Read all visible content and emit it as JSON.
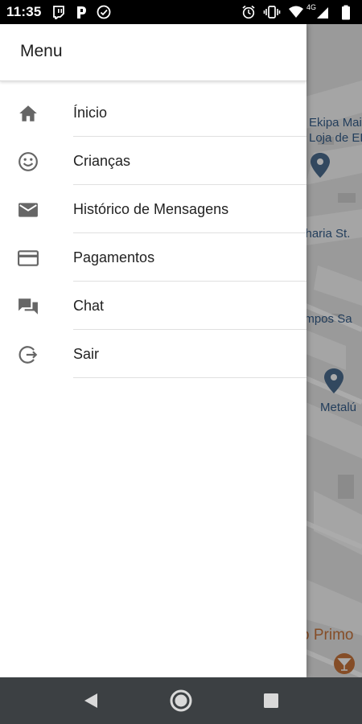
{
  "status_bar": {
    "time": "11:35",
    "left_icons": [
      "twitch-icon",
      "p-icon",
      "check-circle-icon"
    ],
    "right_icons": [
      "alarm-icon",
      "vibrate-icon",
      "wifi-icon",
      "signal-4g-icon",
      "battery-icon"
    ],
    "network": "4G"
  },
  "drawer": {
    "title": "Menu",
    "items": [
      {
        "label": "Ínicio",
        "icon": "home-icon"
      },
      {
        "label": "Crianças",
        "icon": "smiley-icon"
      },
      {
        "label": "Histórico de Mensagens",
        "icon": "mail-icon"
      },
      {
        "label": "Pagamentos",
        "icon": "credit-card-icon"
      },
      {
        "label": "Chat",
        "icon": "chat-icon"
      },
      {
        "label": "Sair",
        "icon": "logout-icon"
      }
    ]
  },
  "map": {
    "labels": [
      "Ekipa Mai",
      "Loja de EF",
      "charia St.",
      "ampos Sa",
      "Metalú",
      "o Primo"
    ]
  },
  "nav_bar": {
    "buttons": [
      "back-icon",
      "home-circle-icon",
      "recents-icon"
    ]
  },
  "colors": {
    "drawer_bg": "#ffffff",
    "icon_gray": "#666666",
    "status_bar": "#000000",
    "nav_bar": "#3c4043",
    "map_pin": "#4b6c8e",
    "poi_orange": "#c7743b"
  }
}
